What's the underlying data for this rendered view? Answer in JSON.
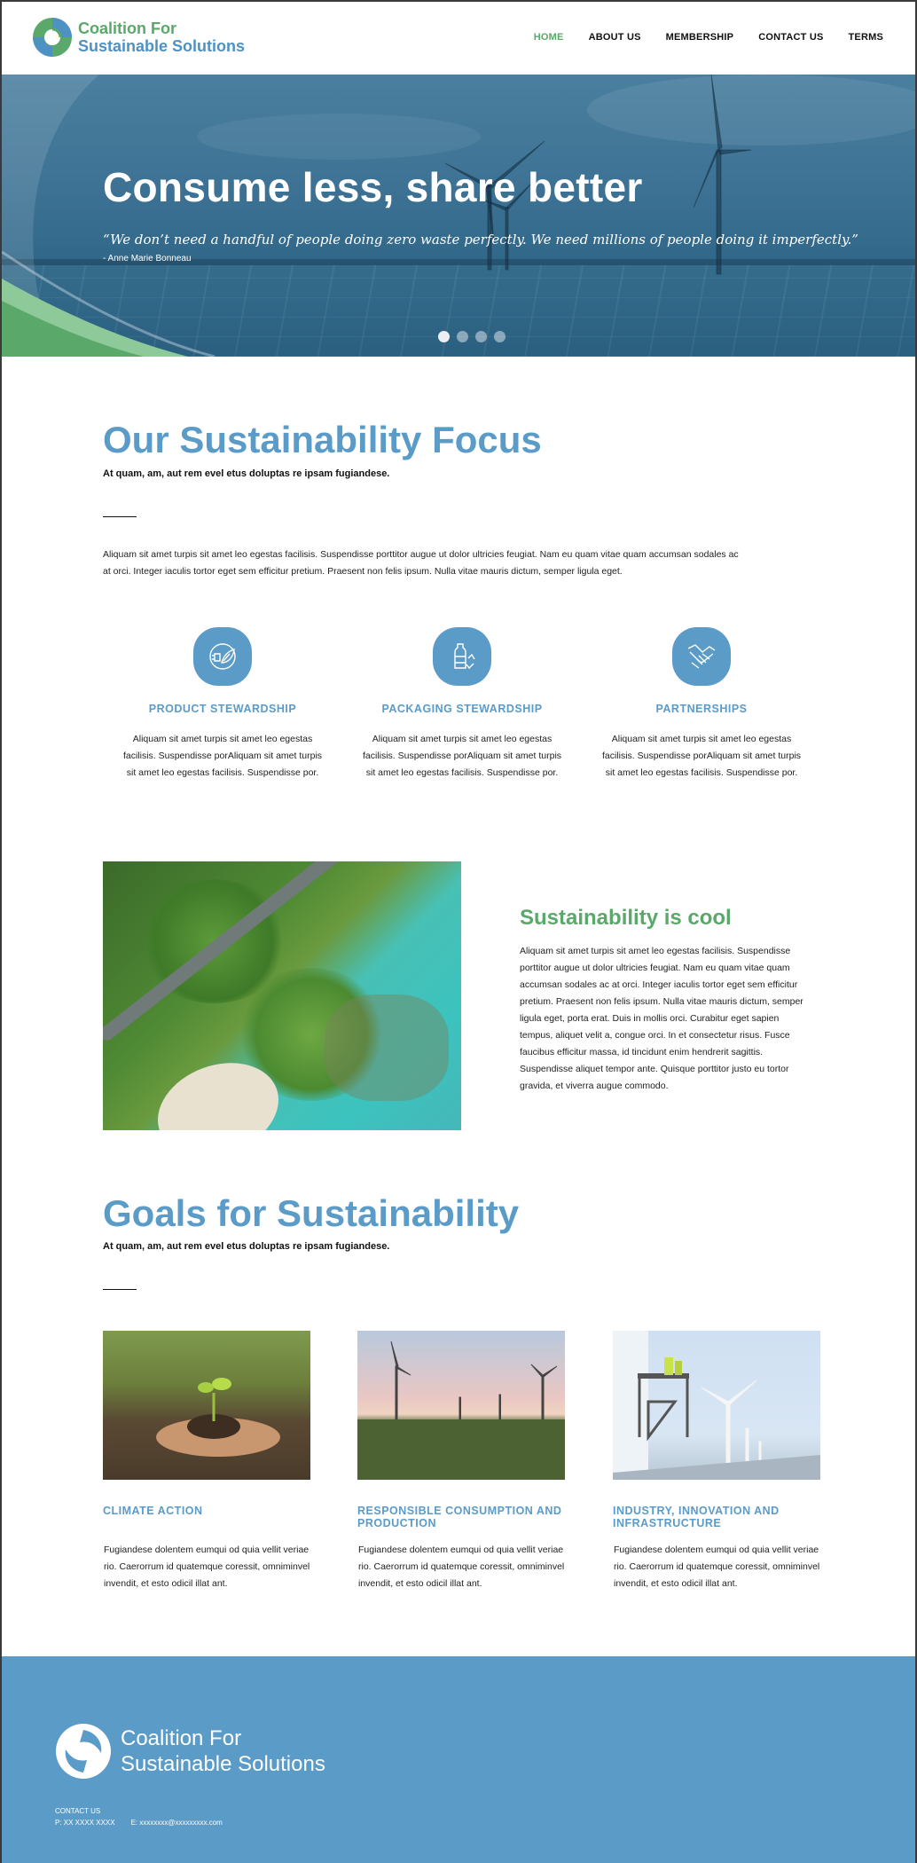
{
  "brand": {
    "line1": "Coalition For",
    "line2": "Sustainable Solutions"
  },
  "nav": {
    "items": [
      "HOME",
      "ABOUT US",
      "MEMBERSHIP",
      "CONTACT US",
      "TERMS"
    ],
    "active": "HOME"
  },
  "hero": {
    "title": "Consume less, share better",
    "quote": "“We don’t need a handful of people doing zero waste perfectly. We need millions of people doing it imperfectly.”",
    "author": "- Anne Marie Bonneau",
    "slides": 4,
    "active_slide": 1
  },
  "focus": {
    "title": "Our Sustainability Focus",
    "subtitle": "At quam, am, aut rem evel etus doluptas re ipsam fugiandese.",
    "intro": "Aliquam sit amet turpis sit amet leo egestas facilisis. Suspendisse porttitor augue ut dolor ultricies feugiat. Nam eu quam vitae quam accumsan sodales ac at orci. Integer iaculis tortor eget sem efficitur pretium. Praesent non felis ipsum. Nulla vitae mauris dictum, semper ligula eget.",
    "features": [
      {
        "icon": "plug-leaf-icon",
        "title": "PRODUCT STEWARDSHIP",
        "text": "Aliquam sit amet turpis sit amet leo egestas facilisis. Suspendisse porAliquam sit amet turpis sit amet leo egestas facilisis. Suspendisse por."
      },
      {
        "icon": "bottle-recycle-icon",
        "title": "PACKAGING STEWARDSHIP",
        "text": "Aliquam sit amet turpis sit amet leo egestas facilisis. Suspendisse porAliquam sit amet turpis sit amet leo egestas facilisis. Suspendisse por."
      },
      {
        "icon": "handshake-icon",
        "title": "PARTNERSHIPS",
        "text": "Aliquam sit amet turpis sit amet leo egestas facilisis. Suspendisse porAliquam sit amet turpis sit amet leo egestas facilisis. Suspendisse por."
      }
    ]
  },
  "cool": {
    "title": "Sustainability is cool",
    "text": "Aliquam sit amet turpis sit amet leo egestas facilisis. Suspendisse porttitor augue ut dolor ultricies feugiat. Nam eu quam vitae quam accumsan sodales ac at orci. Integer iaculis tortor eget sem efficitur pretium. Praesent non felis ipsum. Nulla vitae mauris dictum, semper ligula eget, porta erat. Duis in mollis orci. Curabitur eget sapien tempus, aliquet velit a, congue orci. In et consectetur risus. Fusce faucibus efficitur massa, id tincidunt enim hendrerit sagittis. Suspendisse aliquet tempor ante. Quisque porttitor justo eu tortor gravida, et viverra augue commodo."
  },
  "goals": {
    "title": "Goals for Sustainability",
    "subtitle": "At quam, am, aut rem evel etus doluptas re ipsam fugiandese.",
    "items": [
      {
        "title": "CLIMATE ACTION",
        "text": "Fugiandese dolentem eumqui od quia vellit veriae rio. Caerorrum id quatemque coressit, omniminvel invendit, et esto odicil illat ant."
      },
      {
        "title": "RESPONSIBLE CONSUMPTION AND PRODUCTION",
        "text": "Fugiandese dolentem eumqui od quia vellit veriae rio. Caerorrum id quatemque coressit, omniminvel invendit, et esto odicil illat ant."
      },
      {
        "title": "INDUSTRY, INNOVATION AND INFRASTRUCTURE",
        "text": "Fugiandese dolentem eumqui od quia vellit veriae rio. Caerorrum id quatemque coressit, omniminvel invendit, et esto odicil illat ant."
      }
    ]
  },
  "footer": {
    "brand": {
      "line1": "Coalition For",
      "line2": "Sustainable Solutions"
    },
    "contact_label": "CONTACT US",
    "phone": "P: XX XXXX XXXX",
    "email": "E: xxxxxxxx@xxxxxxxxx.com"
  },
  "colors": {
    "green": "#5aa86a",
    "blue": "#5b9bc8",
    "footer": "#5b9bc8"
  }
}
